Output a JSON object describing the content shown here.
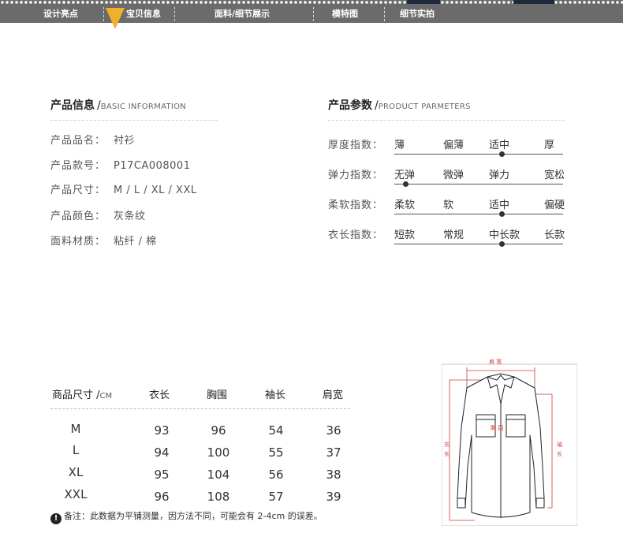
{
  "nav": {
    "items": [
      "设计亮点",
      "宝贝信息",
      "面料/细节展示",
      "模特图",
      "细节实拍"
    ],
    "active_index": 1
  },
  "product_info": {
    "title": "产品信息",
    "subtitle": "BASIC INFORMATION",
    "rows": [
      {
        "label": "产品品名：",
        "value": "衬衫"
      },
      {
        "label": "产品款号：",
        "value": "P17CA008001"
      },
      {
        "label": "产品尺寸：",
        "value": "M / L / XL / XXL"
      },
      {
        "label": "产品颜色：",
        "value": "灰条纹"
      },
      {
        "label": "面料材质：",
        "value": "粘纤 / 棉"
      }
    ]
  },
  "product_params": {
    "title": "产品参数",
    "subtitle": "PRODUCT PARMETERS",
    "rows": [
      {
        "label": "厚度指数：",
        "options": [
          "薄",
          "偏薄",
          "适中",
          "厚"
        ],
        "selected": 2
      },
      {
        "label": "弹力指数：",
        "options": [
          "无弹",
          "微弹",
          "弹力",
          "宽松"
        ],
        "selected": 0
      },
      {
        "label": "柔软指数：",
        "options": [
          "柔软",
          "软",
          "适中",
          "偏硬"
        ],
        "selected": 2
      },
      {
        "label": "衣长指数：",
        "options": [
          "短款",
          "常规",
          "中长款",
          "长款"
        ],
        "selected": 2
      }
    ]
  },
  "size_table": {
    "header_label": "商品尺寸 /",
    "header_unit": "CM",
    "columns": [
      "衣长",
      "胸围",
      "袖长",
      "肩宽"
    ],
    "rows": [
      {
        "size": "M",
        "values": [
          "93",
          "96",
          "54",
          "36"
        ]
      },
      {
        "size": "L",
        "values": [
          "94",
          "100",
          "55",
          "37"
        ]
      },
      {
        "size": "XL",
        "values": [
          "95",
          "104",
          "56",
          "38"
        ]
      },
      {
        "size": "XXL",
        "values": [
          "96",
          "108",
          "57",
          "39"
        ]
      }
    ],
    "note_icon": "!",
    "note": "备注：此数据为平铺测量，因方法不同，可能会有 2-4cm 的误差。"
  },
  "diagram": {
    "shoulder_label": "肩 宽",
    "chest_label": "胸 围",
    "length_label": "衣长",
    "sleeve_label": "袖长",
    "colors": {
      "measure": "#d23a3a",
      "outline": "#222222"
    }
  },
  "colors": {
    "nav_bg": "#6b6b6b",
    "nav_marker": "#f0b02a"
  }
}
